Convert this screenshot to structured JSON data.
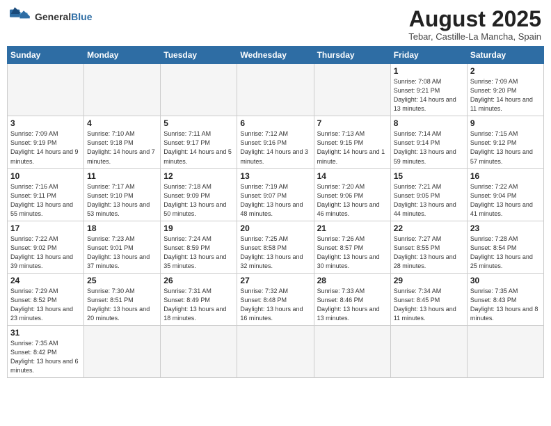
{
  "header": {
    "logo_line1": "General",
    "logo_line2": "Blue",
    "title": "August 2025",
    "subtitle": "Tebar, Castille-La Mancha, Spain"
  },
  "weekdays": [
    "Sunday",
    "Monday",
    "Tuesday",
    "Wednesday",
    "Thursday",
    "Friday",
    "Saturday"
  ],
  "weeks": [
    [
      {
        "day": "",
        "info": ""
      },
      {
        "day": "",
        "info": ""
      },
      {
        "day": "",
        "info": ""
      },
      {
        "day": "",
        "info": ""
      },
      {
        "day": "",
        "info": ""
      },
      {
        "day": "1",
        "info": "Sunrise: 7:08 AM\nSunset: 9:21 PM\nDaylight: 14 hours and 13 minutes."
      },
      {
        "day": "2",
        "info": "Sunrise: 7:09 AM\nSunset: 9:20 PM\nDaylight: 14 hours and 11 minutes."
      }
    ],
    [
      {
        "day": "3",
        "info": "Sunrise: 7:09 AM\nSunset: 9:19 PM\nDaylight: 14 hours and 9 minutes."
      },
      {
        "day": "4",
        "info": "Sunrise: 7:10 AM\nSunset: 9:18 PM\nDaylight: 14 hours and 7 minutes."
      },
      {
        "day": "5",
        "info": "Sunrise: 7:11 AM\nSunset: 9:17 PM\nDaylight: 14 hours and 5 minutes."
      },
      {
        "day": "6",
        "info": "Sunrise: 7:12 AM\nSunset: 9:16 PM\nDaylight: 14 hours and 3 minutes."
      },
      {
        "day": "7",
        "info": "Sunrise: 7:13 AM\nSunset: 9:15 PM\nDaylight: 14 hours and 1 minute."
      },
      {
        "day": "8",
        "info": "Sunrise: 7:14 AM\nSunset: 9:14 PM\nDaylight: 13 hours and 59 minutes."
      },
      {
        "day": "9",
        "info": "Sunrise: 7:15 AM\nSunset: 9:12 PM\nDaylight: 13 hours and 57 minutes."
      }
    ],
    [
      {
        "day": "10",
        "info": "Sunrise: 7:16 AM\nSunset: 9:11 PM\nDaylight: 13 hours and 55 minutes."
      },
      {
        "day": "11",
        "info": "Sunrise: 7:17 AM\nSunset: 9:10 PM\nDaylight: 13 hours and 53 minutes."
      },
      {
        "day": "12",
        "info": "Sunrise: 7:18 AM\nSunset: 9:09 PM\nDaylight: 13 hours and 50 minutes."
      },
      {
        "day": "13",
        "info": "Sunrise: 7:19 AM\nSunset: 9:07 PM\nDaylight: 13 hours and 48 minutes."
      },
      {
        "day": "14",
        "info": "Sunrise: 7:20 AM\nSunset: 9:06 PM\nDaylight: 13 hours and 46 minutes."
      },
      {
        "day": "15",
        "info": "Sunrise: 7:21 AM\nSunset: 9:05 PM\nDaylight: 13 hours and 44 minutes."
      },
      {
        "day": "16",
        "info": "Sunrise: 7:22 AM\nSunset: 9:04 PM\nDaylight: 13 hours and 41 minutes."
      }
    ],
    [
      {
        "day": "17",
        "info": "Sunrise: 7:22 AM\nSunset: 9:02 PM\nDaylight: 13 hours and 39 minutes."
      },
      {
        "day": "18",
        "info": "Sunrise: 7:23 AM\nSunset: 9:01 PM\nDaylight: 13 hours and 37 minutes."
      },
      {
        "day": "19",
        "info": "Sunrise: 7:24 AM\nSunset: 8:59 PM\nDaylight: 13 hours and 35 minutes."
      },
      {
        "day": "20",
        "info": "Sunrise: 7:25 AM\nSunset: 8:58 PM\nDaylight: 13 hours and 32 minutes."
      },
      {
        "day": "21",
        "info": "Sunrise: 7:26 AM\nSunset: 8:57 PM\nDaylight: 13 hours and 30 minutes."
      },
      {
        "day": "22",
        "info": "Sunrise: 7:27 AM\nSunset: 8:55 PM\nDaylight: 13 hours and 28 minutes."
      },
      {
        "day": "23",
        "info": "Sunrise: 7:28 AM\nSunset: 8:54 PM\nDaylight: 13 hours and 25 minutes."
      }
    ],
    [
      {
        "day": "24",
        "info": "Sunrise: 7:29 AM\nSunset: 8:52 PM\nDaylight: 13 hours and 23 minutes."
      },
      {
        "day": "25",
        "info": "Sunrise: 7:30 AM\nSunset: 8:51 PM\nDaylight: 13 hours and 20 minutes."
      },
      {
        "day": "26",
        "info": "Sunrise: 7:31 AM\nSunset: 8:49 PM\nDaylight: 13 hours and 18 minutes."
      },
      {
        "day": "27",
        "info": "Sunrise: 7:32 AM\nSunset: 8:48 PM\nDaylight: 13 hours and 16 minutes."
      },
      {
        "day": "28",
        "info": "Sunrise: 7:33 AM\nSunset: 8:46 PM\nDaylight: 13 hours and 13 minutes."
      },
      {
        "day": "29",
        "info": "Sunrise: 7:34 AM\nSunset: 8:45 PM\nDaylight: 13 hours and 11 minutes."
      },
      {
        "day": "30",
        "info": "Sunrise: 7:35 AM\nSunset: 8:43 PM\nDaylight: 13 hours and 8 minutes."
      }
    ],
    [
      {
        "day": "31",
        "info": "Sunrise: 7:35 AM\nSunset: 8:42 PM\nDaylight: 13 hours and 6 minutes."
      },
      {
        "day": "",
        "info": ""
      },
      {
        "day": "",
        "info": ""
      },
      {
        "day": "",
        "info": ""
      },
      {
        "day": "",
        "info": ""
      },
      {
        "day": "",
        "info": ""
      },
      {
        "day": "",
        "info": ""
      }
    ]
  ]
}
